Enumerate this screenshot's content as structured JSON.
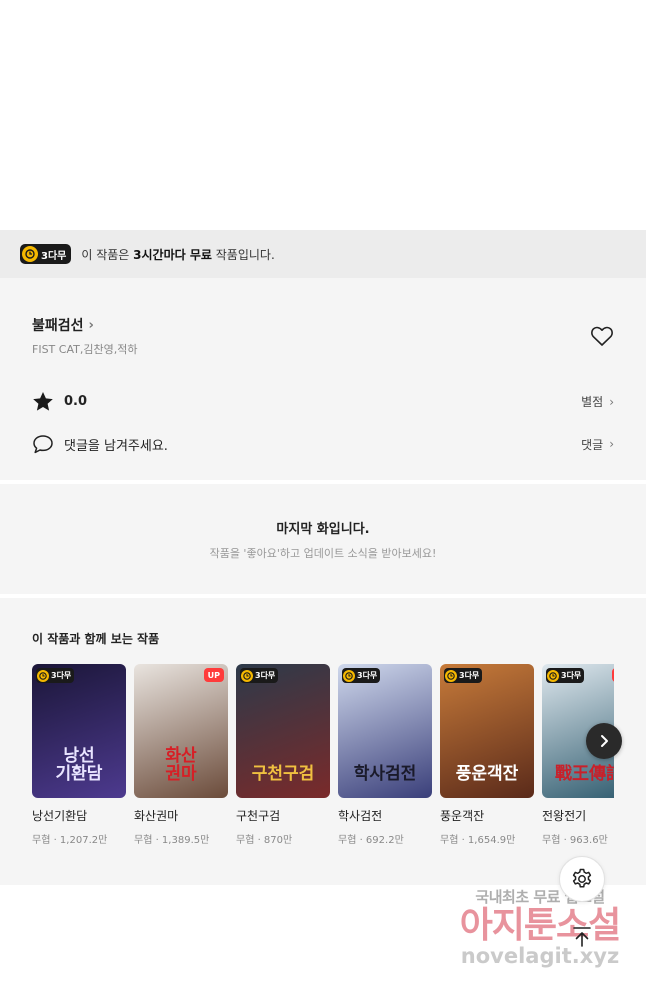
{
  "notice": {
    "badge": "3다무",
    "prefix": "이 작품은 ",
    "highlight": "3시간마다 무료",
    "suffix": " 작품입니다."
  },
  "work": {
    "title": "불패검선",
    "authors": "FIST CAT,김찬영,적하",
    "rating": "0.0",
    "rating_link": "별점",
    "comment_prompt": "댓글을 남겨주세요.",
    "comment_link": "댓글"
  },
  "end": {
    "title": "마지막 화입니다.",
    "subtitle": "작품을 '좋아요'하고 업데이트 소식을 받아보세요!"
  },
  "recommend": {
    "heading": "이 작품과 함께 보는 작품",
    "items": [
      {
        "name": "낭선기환담",
        "meta": "무협 · 1,207.2만",
        "badge": "3다무",
        "up": "",
        "cover_text": "낭선\n기환담",
        "bg1": "#1b1638",
        "bg2": "#4d3a8f",
        "fg": "#e8e4ff"
      },
      {
        "name": "화산권마",
        "meta": "무협 · 1,389.5만",
        "badge": "",
        "up": "UP",
        "cover_text": "화산\n권마",
        "bg1": "#e9e4df",
        "bg2": "#6b4b3a",
        "fg": "#d61f26"
      },
      {
        "name": "구천구검",
        "meta": "무협 · 870만",
        "badge": "3다무",
        "up": "",
        "cover_text": "구천구검",
        "bg1": "#2d3a4a",
        "bg2": "#7a2a2a",
        "fg": "#f0c040"
      },
      {
        "name": "학사검전",
        "meta": "무협 · 692.2만",
        "badge": "3다무",
        "up": "",
        "cover_text": "학사검전",
        "bg1": "#cfd8ec",
        "bg2": "#3a3f7a",
        "fg": "#1a1a2a"
      },
      {
        "name": "풍운객잔",
        "meta": "무협 · 1,654.9만",
        "badge": "3다무",
        "up": "",
        "cover_text": "풍운객잔",
        "bg1": "#c77b3a",
        "bg2": "#5a2a1a",
        "fg": "#ffffff"
      },
      {
        "name": "전왕전기",
        "meta": "무협 · 963.6만",
        "badge": "3다무",
        "up": "UP",
        "cover_text": "戰王傳記",
        "bg1": "#dfe8ee",
        "bg2": "#2f5b6e",
        "fg": "#c8202a"
      }
    ]
  },
  "watermark": {
    "line1": "국내최초 무료 웹소설",
    "line2": "아지툰소설",
    "line3": "novelagit.xyz"
  },
  "icons": [
    "clock-icon",
    "heart-icon",
    "star-icon",
    "comment-icon",
    "chevron-right-icon",
    "gear-icon",
    "arrow-up-icon"
  ]
}
